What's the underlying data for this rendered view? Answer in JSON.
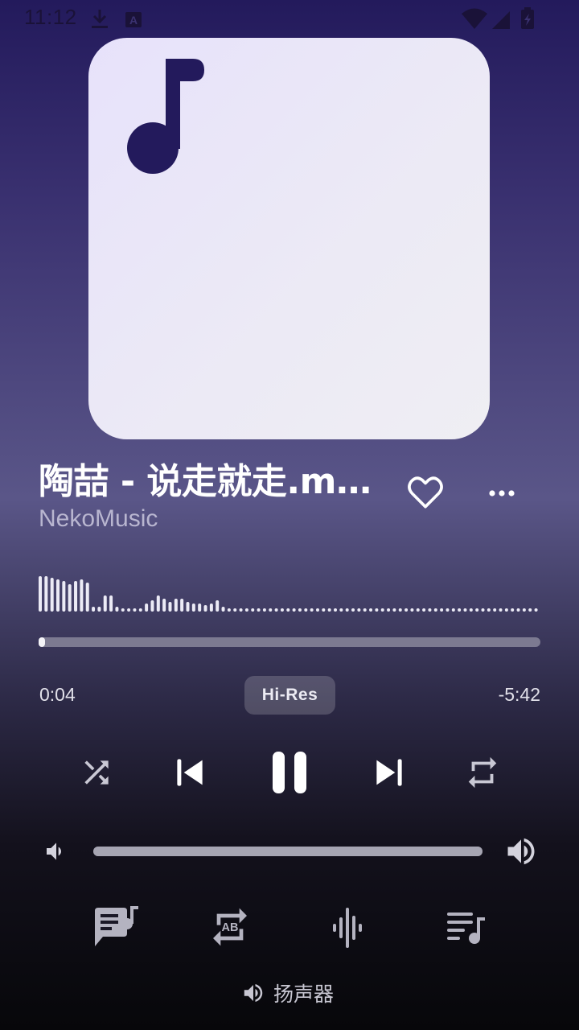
{
  "status_bar": {
    "time": "11:12",
    "icons_left": [
      "download-icon",
      "a-badge-icon"
    ],
    "icons_right": [
      "wifi-icon",
      "signal-icon",
      "battery-charging-icon"
    ]
  },
  "track": {
    "title": "陶喆 - 说走就走.m…",
    "artist": "NekoMusic",
    "artwork_icon": "music-note-icon"
  },
  "playback": {
    "elapsed": "0:04",
    "remaining": "-5:42",
    "progress_fraction": 0.012,
    "quality_badge": "Hi-Res"
  },
  "controls": [
    "shuffle-icon",
    "skip-previous-icon",
    "pause-icon",
    "skip-next-icon",
    "repeat-icon"
  ],
  "volume": {
    "level_fraction": 1.0
  },
  "tools": [
    "lyrics-icon",
    "ab-repeat-icon",
    "equalizer-icon",
    "queue-icon"
  ],
  "output": {
    "label": "扬声器",
    "icon": "speaker-icon"
  },
  "colors": {
    "accent": "#231a5c",
    "artwork_bg": "#ebe8f7",
    "text_secondary": "#b9b6d0"
  }
}
